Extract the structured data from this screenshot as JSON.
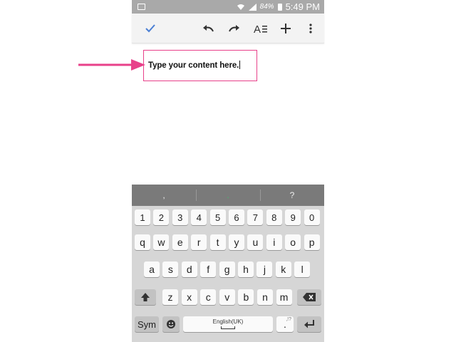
{
  "status_bar": {
    "battery": "84%",
    "time": "5:49 PM"
  },
  "toolbar": {
    "icons": [
      "check-icon",
      "undo-icon",
      "redo-icon",
      "text-format-icon",
      "add-icon",
      "more-vert-icon"
    ]
  },
  "document": {
    "text": "Type your content here."
  },
  "colors": {
    "accent": "#4a7fd4",
    "highlight": "#e8418a"
  },
  "keyboard": {
    "suggestions": [
      ",",
      ".",
      "?"
    ],
    "number_row": [
      "1",
      "2",
      "3",
      "4",
      "5",
      "6",
      "7",
      "8",
      "9",
      "0"
    ],
    "row1": [
      "q",
      "w",
      "e",
      "r",
      "t",
      "y",
      "u",
      "i",
      "o",
      "p"
    ],
    "row2": [
      "a",
      "s",
      "d",
      "f",
      "g",
      "h",
      "j",
      "k",
      "l"
    ],
    "row3": [
      "z",
      "x",
      "c",
      "v",
      "b",
      "n",
      "m"
    ],
    "sym_label": "Sym",
    "space_label": "English(UK)",
    "period_label": ".",
    "period_hint": ",!?"
  }
}
